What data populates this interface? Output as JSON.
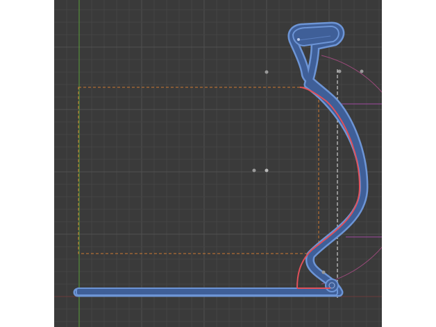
{
  "viewport": {
    "background": "#3a3a3a",
    "grid_minor_color": "#444444",
    "grid_major_color": "#505050",
    "axis_y_color": "#5a9e3a",
    "axis_x_color": "#a33a3a",
    "selection_fill": "#4a6fb0",
    "selection_outline": "#6d95d6",
    "curve_color": "#e0505a",
    "guide_color": "#d07a32",
    "guide_line_color": "#e8e8e8"
  },
  "icons": {
    "vertex-point-icon": "point",
    "origin-icon": "origin",
    "pivot-icon": "pivot"
  }
}
